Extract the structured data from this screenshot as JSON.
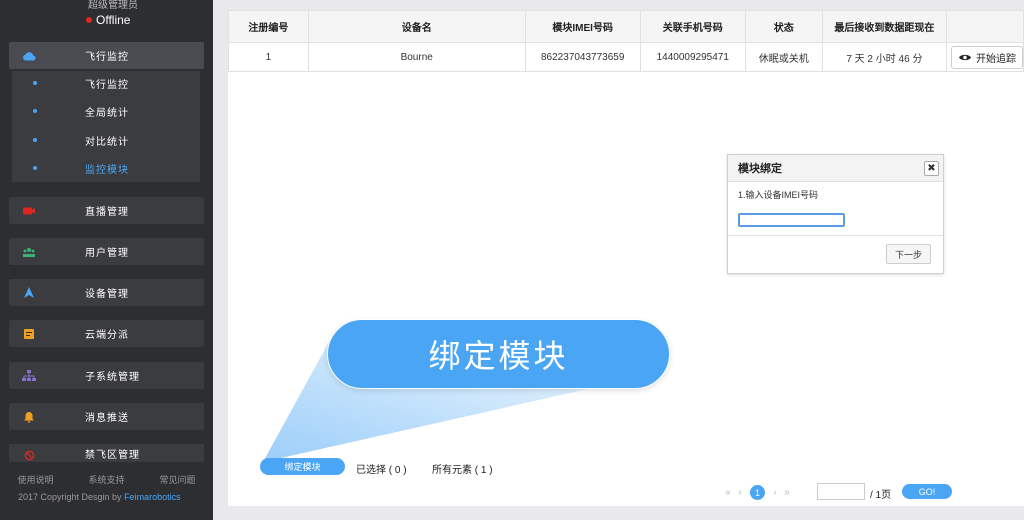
{
  "sidebar": {
    "user_role": "超级管理员",
    "status": "Offline",
    "menu": [
      {
        "label": "飞行监控",
        "icon": "cloud-icon",
        "color": "#4aa6f5",
        "active": true
      },
      {
        "label": "直播管理",
        "icon": "video-camera-icon",
        "color": "#e02424"
      },
      {
        "label": "用户管理",
        "icon": "users-icon",
        "color": "#3cb371"
      },
      {
        "label": "设备管理",
        "icon": "navigation-arrow-icon",
        "color": "#4aa6f5"
      },
      {
        "label": "云端分派",
        "icon": "clipboard-icon",
        "color": "#f0a020"
      },
      {
        "label": "子系统管理",
        "icon": "sitemap-icon",
        "color": "#8a6fd1"
      },
      {
        "label": "消息推送",
        "icon": "bell-icon",
        "color": "#f0a020"
      },
      {
        "label": "禁飞区管理",
        "icon": "ban-icon",
        "color": "#e02424"
      }
    ],
    "submenu": [
      {
        "label": "飞行监控"
      },
      {
        "label": "全局统计"
      },
      {
        "label": "对比统计"
      },
      {
        "label": "监控模块",
        "current": true
      }
    ],
    "footer_links": [
      "使用说明",
      "系统支持",
      "常见问题"
    ],
    "copyright_prefix": "2017 Copyright Desgin by ",
    "copyright_brand": "Feimarobotics"
  },
  "table": {
    "headers": [
      "注册编号",
      "设备名",
      "模块IMEI号码",
      "关联手机号码",
      "状态",
      "最后接收到数据距现在",
      ""
    ],
    "rows": [
      {
        "id": "1",
        "name": "Bourne",
        "imei": "862237043773659",
        "phone": "1440009295471",
        "status": "休眠或关机",
        "last_data": "7 天 2 小时 46 分",
        "action": "开始追踪"
      }
    ]
  },
  "dialog": {
    "title": "模块绑定",
    "step": "1.输入设备IMEI号码",
    "imei_value": "",
    "next_label": "下一步"
  },
  "callout": {
    "text": "绑定模块"
  },
  "bottom": {
    "bind_label": "绑定模块",
    "selected": "已选择 ( 0 )",
    "total": "所有元素 ( 1 )",
    "pager": {
      "current_page": "1",
      "total_pages": "/ 1页",
      "go_label": "GO!"
    }
  },
  "colors": {
    "accent": "#4aa6f5",
    "sidebar_bg": "#2d2e31",
    "offline": "#e02424"
  }
}
